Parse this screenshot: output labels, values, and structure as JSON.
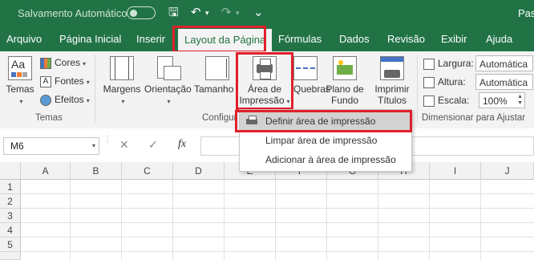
{
  "titlebar": {
    "autosave_label": "Salvamento Automático",
    "save_glyph": "🖫",
    "undo_glyph": "↶",
    "redo_glyph": "↷",
    "more_glyph": "⌄",
    "app_name": "Pasta"
  },
  "tabs": [
    {
      "label": "Arquivo"
    },
    {
      "label": "Página Inicial"
    },
    {
      "label": "Inserir"
    },
    {
      "label": "Layout da Página"
    },
    {
      "label": "Fórmulas"
    },
    {
      "label": "Dados"
    },
    {
      "label": "Revisão"
    },
    {
      "label": "Exibir"
    },
    {
      "label": "Ajuda"
    }
  ],
  "ribbon": {
    "temas": {
      "button": "Temas",
      "cores": "Cores",
      "fontes": "Fontes",
      "efeitos": "Efeitos",
      "group": "Temas"
    },
    "configurar": {
      "margens": "Margens",
      "orientacao": "Orientação",
      "tamanho": "Tamanho",
      "area_line1": "Área de",
      "area_line2": "Impressão",
      "quebras": "Quebras",
      "plano_line1": "Plano de",
      "plano_line2": "Fundo",
      "imprimir_line1": "Imprimir",
      "imprimir_line2": "Títulos",
      "group": "Configur"
    },
    "dimensionar": {
      "largura_label": "Largura:",
      "largura_value": "Automática",
      "altura_label": "Altura:",
      "altura_value": "Automática",
      "escala_label": "Escala:",
      "escala_value": "100%",
      "group": "Dimensionar para Ajustar"
    }
  },
  "formula_bar": {
    "name_box": "M6",
    "cancel_glyph": "✕",
    "enter_glyph": "✓",
    "fx_glyph": "fx"
  },
  "grid": {
    "columns": [
      "A",
      "B",
      "C",
      "D",
      "E",
      "F",
      "G",
      "H",
      "I",
      "J"
    ],
    "rows": [
      "1",
      "2",
      "3",
      "4",
      "5"
    ]
  },
  "menu": {
    "items": [
      {
        "label": "Definir área de impressão",
        "highlighted": true
      },
      {
        "label": "Limpar área de impressão",
        "highlighted": false
      },
      {
        "label": "Adicionar à área de impressão",
        "highlighted": false
      }
    ]
  },
  "colors": {
    "excel_green": "#217346",
    "highlight_red": "#e0202a"
  }
}
